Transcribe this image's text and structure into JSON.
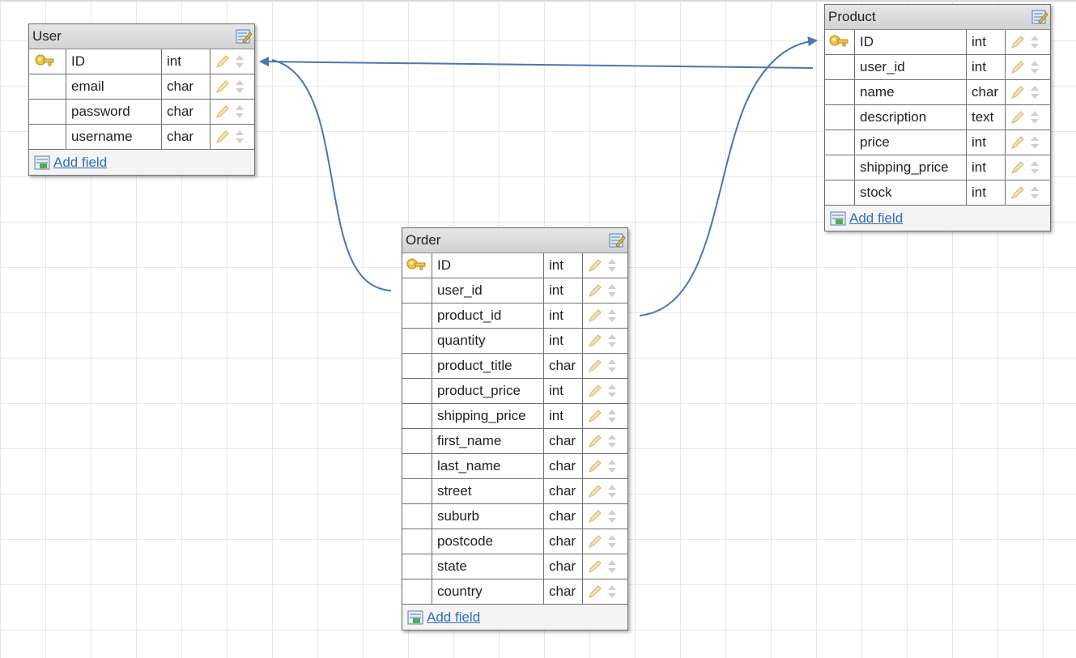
{
  "tables": {
    "user": {
      "title": "User",
      "fields": [
        {
          "name": "ID",
          "type": "int",
          "primary_key": true
        },
        {
          "name": "email",
          "type": "char",
          "primary_key": false
        },
        {
          "name": "password",
          "type": "char",
          "primary_key": false
        },
        {
          "name": "username",
          "type": "char",
          "primary_key": false
        }
      ],
      "add_field_label": "Add field"
    },
    "product": {
      "title": "Product",
      "fields": [
        {
          "name": "ID",
          "type": "int",
          "primary_key": true
        },
        {
          "name": "user_id",
          "type": "int",
          "primary_key": false
        },
        {
          "name": "name",
          "type": "char",
          "primary_key": false
        },
        {
          "name": "description",
          "type": "text",
          "primary_key": false
        },
        {
          "name": "price",
          "type": "int",
          "primary_key": false
        },
        {
          "name": "shipping_price",
          "type": "int",
          "primary_key": false
        },
        {
          "name": "stock",
          "type": "int",
          "primary_key": false
        }
      ],
      "add_field_label": "Add field"
    },
    "order": {
      "title": "Order",
      "fields": [
        {
          "name": "ID",
          "type": "int",
          "primary_key": true
        },
        {
          "name": "user_id",
          "type": "int",
          "primary_key": false
        },
        {
          "name": "product_id",
          "type": "int",
          "primary_key": false
        },
        {
          "name": "quantity",
          "type": "int",
          "primary_key": false
        },
        {
          "name": "product_title",
          "type": "char",
          "primary_key": false
        },
        {
          "name": "product_price",
          "type": "int",
          "primary_key": false
        },
        {
          "name": "shipping_price",
          "type": "int",
          "primary_key": false
        },
        {
          "name": "first_name",
          "type": "char",
          "primary_key": false
        },
        {
          "name": "last_name",
          "type": "char",
          "primary_key": false
        },
        {
          "name": "street",
          "type": "char",
          "primary_key": false
        },
        {
          "name": "suburb",
          "type": "char",
          "primary_key": false
        },
        {
          "name": "postcode",
          "type": "char",
          "primary_key": false
        },
        {
          "name": "state",
          "type": "char",
          "primary_key": false
        },
        {
          "name": "country",
          "type": "char",
          "primary_key": false
        }
      ],
      "add_field_label": "Add field"
    }
  },
  "relations": [
    {
      "from": "Product.user_id",
      "to": "User.ID"
    },
    {
      "from": "Order.user_id",
      "to": "User.ID"
    },
    {
      "from": "Order.product_id",
      "to": "Product.ID"
    }
  ],
  "icons": {
    "primary_key": "key-icon",
    "edit_field": "pencil-icon",
    "reorder_field": "move-arrows-icon",
    "edit_table": "edit-table-icon",
    "add_field": "add-field-icon"
  },
  "colors": {
    "link_line": "#4a77b0",
    "header_bg": "#d8d8d8",
    "link_text": "#2f6eb5"
  }
}
